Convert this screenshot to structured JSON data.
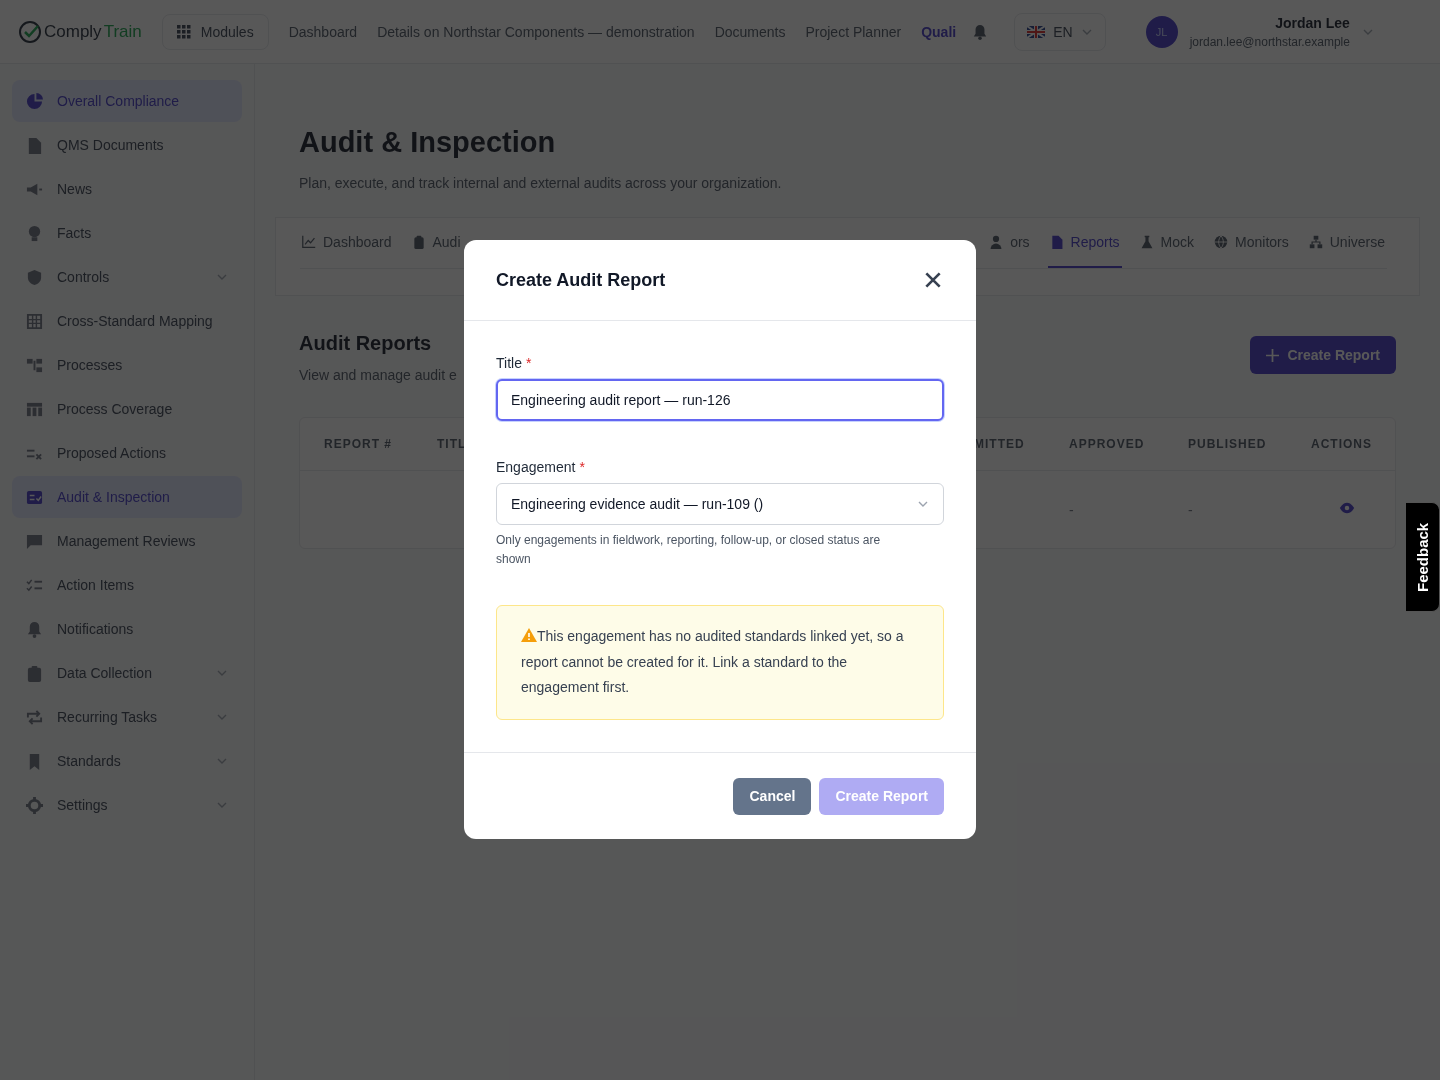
{
  "header": {
    "logo_prefix": "Comply",
    "logo_suffix": "Train",
    "modules_button": "Modules",
    "nav": [
      {
        "label": "Dashboard",
        "selected": false
      },
      {
        "label": "Details on Northstar Components — demonstration",
        "selected": false
      },
      {
        "label": "Documents",
        "selected": false
      },
      {
        "label": "Project Planner",
        "selected": false
      },
      {
        "label": "Quali",
        "selected": true
      }
    ],
    "language": "EN",
    "user": {
      "initials": "JL",
      "name": "Jordan Lee",
      "email": "jordan.lee@northstar.example"
    }
  },
  "sidebar": {
    "items": [
      {
        "label": "Overall Compliance",
        "selected": true,
        "expandable": false
      },
      {
        "label": "QMS Documents",
        "selected": false,
        "expandable": false
      },
      {
        "label": "News",
        "selected": false,
        "expandable": false
      },
      {
        "label": "Facts",
        "selected": false,
        "expandable": false
      },
      {
        "label": "Controls",
        "selected": false,
        "expandable": true
      },
      {
        "label": "Cross-Standard Mapping",
        "selected": false,
        "expandable": false
      },
      {
        "label": "Processes",
        "selected": false,
        "expandable": false
      },
      {
        "label": "Process Coverage",
        "selected": false,
        "expandable": false
      },
      {
        "label": "Proposed Actions",
        "selected": false,
        "expandable": false
      },
      {
        "label": "Audit & Inspection",
        "selected": true,
        "expandable": false
      },
      {
        "label": "Management Reviews",
        "selected": false,
        "expandable": false
      },
      {
        "label": "Action Items",
        "selected": false,
        "expandable": false
      },
      {
        "label": "Notifications",
        "selected": false,
        "expandable": false
      },
      {
        "label": "Data Collection",
        "selected": false,
        "expandable": true
      },
      {
        "label": "Recurring Tasks",
        "selected": false,
        "expandable": true
      },
      {
        "label": "Standards",
        "selected": false,
        "expandable": true
      },
      {
        "label": "Settings",
        "selected": false,
        "expandable": true
      }
    ]
  },
  "page": {
    "title": "Audit & Inspection",
    "subtitle": "Plan, execute, and track internal and external audits across your organization."
  },
  "tabs": {
    "left": [
      {
        "label": "Dashboard",
        "selected": false
      },
      {
        "label": "Audi",
        "selected": false
      }
    ],
    "right": [
      {
        "label": "ors",
        "selected": false
      },
      {
        "label": "Reports",
        "selected": true
      },
      {
        "label": "Mock",
        "selected": false
      },
      {
        "label": "Monitors",
        "selected": false
      },
      {
        "label": "Universe",
        "selected": false
      }
    ]
  },
  "section": {
    "title": "Audit Reports",
    "subtitle": "View and manage audit e",
    "create_button": "Create Report"
  },
  "table": {
    "columns_left": [
      "REPORT #",
      "TITL"
    ],
    "columns_right": [
      "MITTED",
      "APPROVED",
      "PUBLISHED",
      "ACTIONS"
    ],
    "row_right": [
      "-",
      "-"
    ]
  },
  "dialog": {
    "title": "Create Audit Report",
    "fields": [
      {
        "kind": "text",
        "label": "Title",
        "required_mark": "*",
        "focused": true,
        "value": "Engineering audit report — run-126"
      },
      {
        "kind": "select",
        "label": "Engagement",
        "required_mark": "*",
        "focused": false,
        "value": "Engineering evidence audit — run-109 ()",
        "hint": "Only engagements in fieldwork, reporting, follow-up, or closed status are shown"
      }
    ],
    "warning": "This engagement has no audited standards linked yet, so a report cannot be created for it. Link a standard to the engagement first.",
    "buttons": [
      {
        "label": "Cancel",
        "kind": "secondary",
        "disabled": false
      },
      {
        "label": "Create Report",
        "kind": "primary",
        "disabled": true
      }
    ]
  },
  "feedback": "Feedback"
}
